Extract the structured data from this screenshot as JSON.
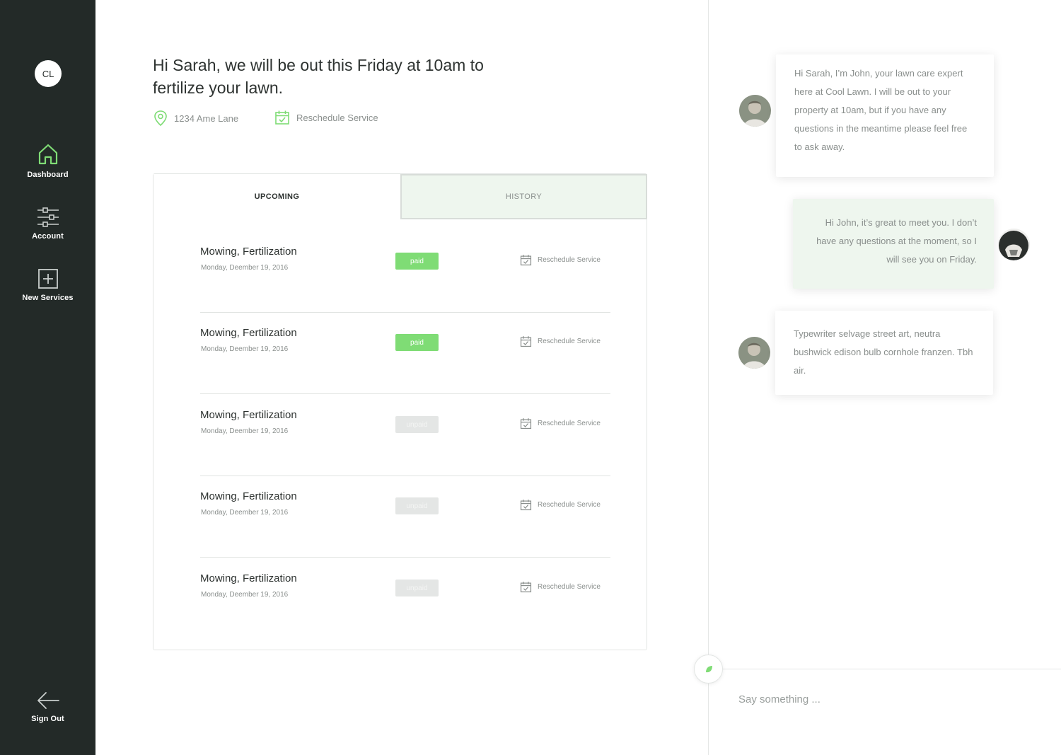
{
  "sidebar": {
    "avatar_initials": "CL",
    "items": [
      {
        "label": "Dashboard",
        "icon": "home-icon",
        "active": true,
        "color": "#7fdc75"
      },
      {
        "label": "Account",
        "icon": "sliders-icon"
      },
      {
        "label": "New Services",
        "icon": "plus-square-icon"
      }
    ],
    "signout_label": "Sign Out"
  },
  "main": {
    "headline": "Hi Sarah, we will be out this Friday at 10am to fertilize your lawn.",
    "address": "1234 Ame Lane",
    "reschedule_label": "Reschedule Service",
    "tabs": [
      {
        "label": "UPCOMING",
        "active": true
      },
      {
        "label": "HISTORY",
        "active": false
      }
    ],
    "services": [
      {
        "title": "Mowing, Fertilization",
        "date": "Monday, Deember 19, 2016",
        "status": "paid",
        "action": "Reschedule Service"
      },
      {
        "title": "Mowing, Fertilization",
        "date": "Monday, Deember 19, 2016",
        "status": "paid",
        "action": "Reschedule Service"
      },
      {
        "title": "Mowing, Fertilization",
        "date": "Monday, Deember 19, 2016",
        "status": "unpaid",
        "action": "Reschedule Service"
      },
      {
        "title": "Mowing, Fertilization",
        "date": "Monday, Deember 19, 2016",
        "status": "unpaid",
        "action": "Reschedule Service"
      },
      {
        "title": "Mowing, Fertilization",
        "date": "Monday, Deember 19, 2016",
        "status": "unpaid",
        "action": "Reschedule Service"
      }
    ]
  },
  "chat": {
    "messages": [
      {
        "from": "John",
        "text": "Hi Sarah, I’m John, your lawn care expert here at Cool Lawn. I will be out to your property at 10am, but if you have any questions in the meantime please feel free to ask away."
      },
      {
        "from": "Sarah",
        "text": "Hi John, it’s great to meet you. I don’t have any questions at the moment, so I will see you on Friday."
      },
      {
        "from": "John",
        "text": "Typewriter selvage street art, neutra bushwick edison bulb cornhole franzen. Tbh air."
      }
    ],
    "input_placeholder": "Say something ..."
  },
  "colors": {
    "sidebar_bg": "#232a28",
    "accent_green": "#7fdc75",
    "history_tab_bg": "#eef6ee",
    "unpaid_badge": "#e4e6e5"
  }
}
